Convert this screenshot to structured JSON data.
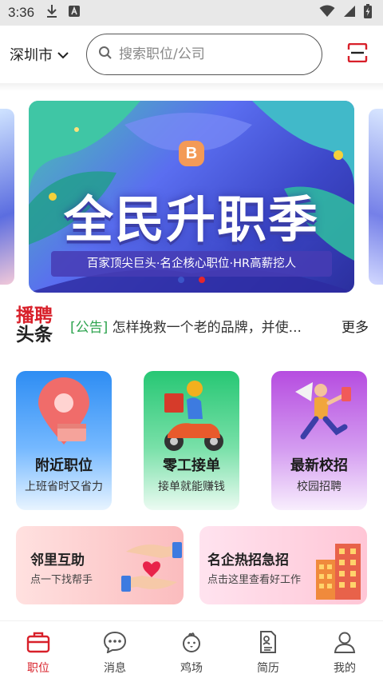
{
  "status_bar": {
    "time": "3:36"
  },
  "top_bar": {
    "city": "深圳市",
    "search_placeholder": "搜索职位/公司"
  },
  "banner": {
    "badge": "B",
    "title": "全民升职季",
    "subtitle": "百家顶尖巨头·名企核心职位·HR高薪挖人",
    "slide_count": 2,
    "active_slide": 2
  },
  "headline": {
    "logo_line1": "播聘",
    "logo_line2": "头条",
    "tag": "[公告]",
    "text": " 怎样挽救一个老的品牌，并使...",
    "more": "更多"
  },
  "cards": [
    {
      "title": "附近职位",
      "subtitle": "上班省时又省力"
    },
    {
      "title": "零工接单",
      "subtitle": "接单就能赚钱"
    },
    {
      "title": "最新校招",
      "subtitle": "校园招聘"
    }
  ],
  "promos": [
    {
      "title": "邻里互助",
      "subtitle": "点一下找帮手"
    },
    {
      "title": "名企热招急招",
      "subtitle": "点击这里查看好工作"
    }
  ],
  "bottom_nav": [
    {
      "label": "职位",
      "icon": "briefcase-icon",
      "active": true
    },
    {
      "label": "消息",
      "icon": "chat-bubble-icon",
      "active": false
    },
    {
      "label": "鸡场",
      "icon": "chick-icon",
      "active": false
    },
    {
      "label": "简历",
      "icon": "resume-icon",
      "active": false
    },
    {
      "label": "我的",
      "icon": "user-icon",
      "active": false
    }
  ],
  "colors": {
    "accent": "#d8202a",
    "headline_tag": "#2ea44f"
  }
}
